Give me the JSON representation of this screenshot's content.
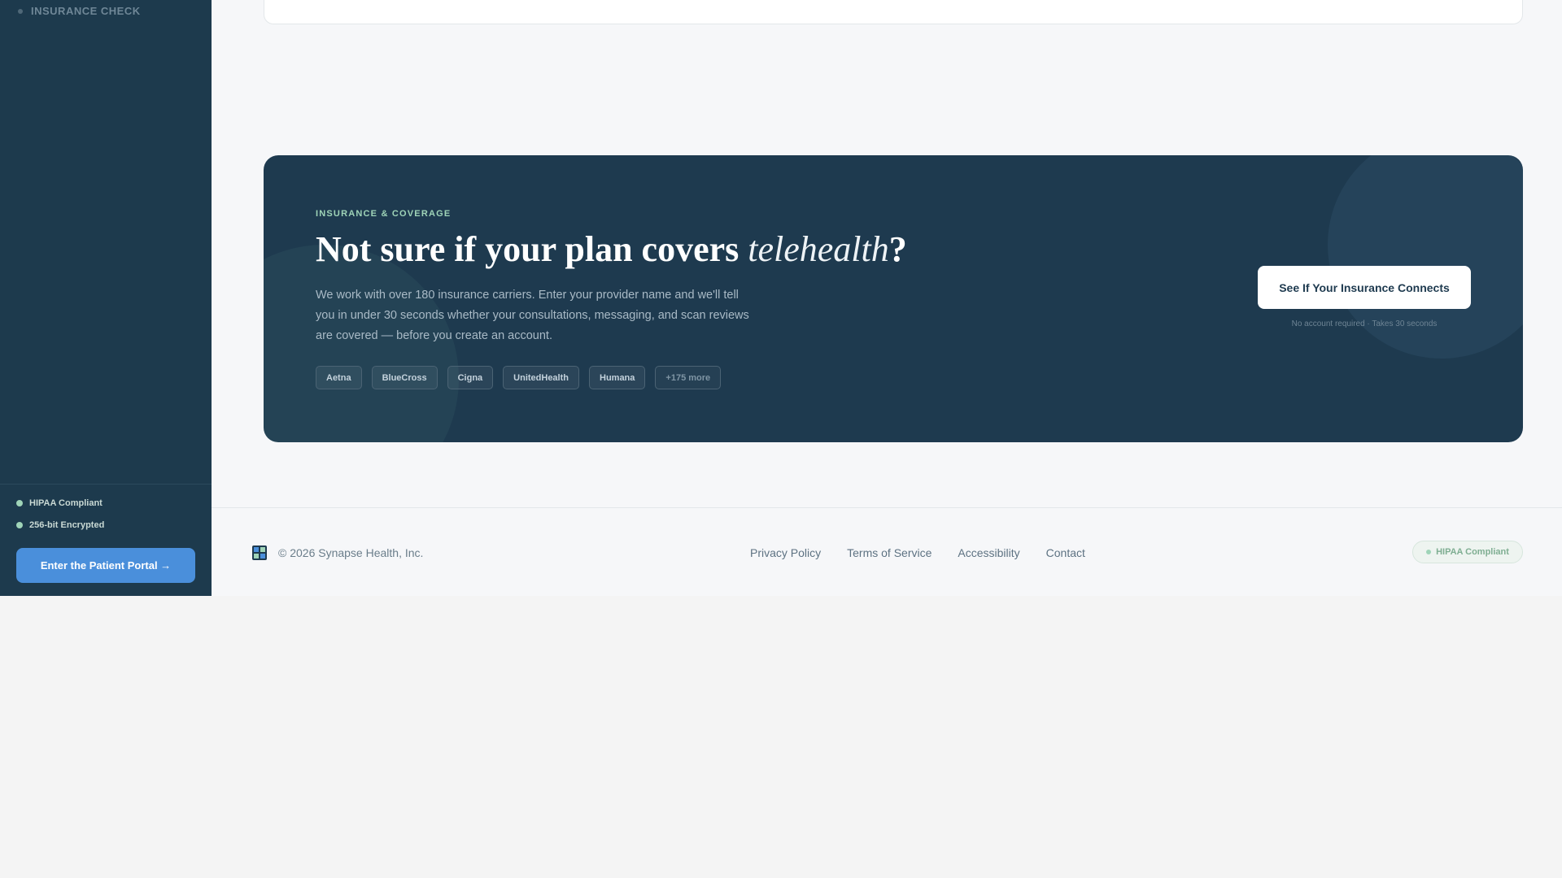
{
  "sidebar": {
    "nav_item": "INSURANCE CHECK",
    "trust": [
      "HIPAA Compliant",
      "256-bit Encrypted"
    ],
    "portal_button": "Enter the Patient Portal →"
  },
  "cta": {
    "eyebrow": "INSURANCE & COVERAGE",
    "headline_main": "Not sure if your plan covers ",
    "headline_italic": "telehealth",
    "headline_end": "?",
    "description": "We work with over 180 insurance carriers. Enter your provider name and we'll tell you in under 30 seconds whether your consultations, messaging, and scan reviews are covered — before you create an account.",
    "carriers": [
      "Aetna",
      "BlueCross",
      "Cigna",
      "UnitedHealth",
      "Humana",
      "+175 more"
    ],
    "button": "See If Your Insurance Connects",
    "button_note": "No account required · Takes 30 seconds"
  },
  "footer": {
    "copyright": "© 2026 Synapse Health, Inc.",
    "links": [
      "Privacy Policy",
      "Terms of Service",
      "Accessibility",
      "Contact"
    ],
    "badge": "HIPAA Compliant"
  },
  "colors": {
    "sidebar_bg": "#1d3a4d",
    "card_bg": "#1e3a4f",
    "accent_blue": "#4a8fdb",
    "accent_green": "#9fd4b8"
  }
}
